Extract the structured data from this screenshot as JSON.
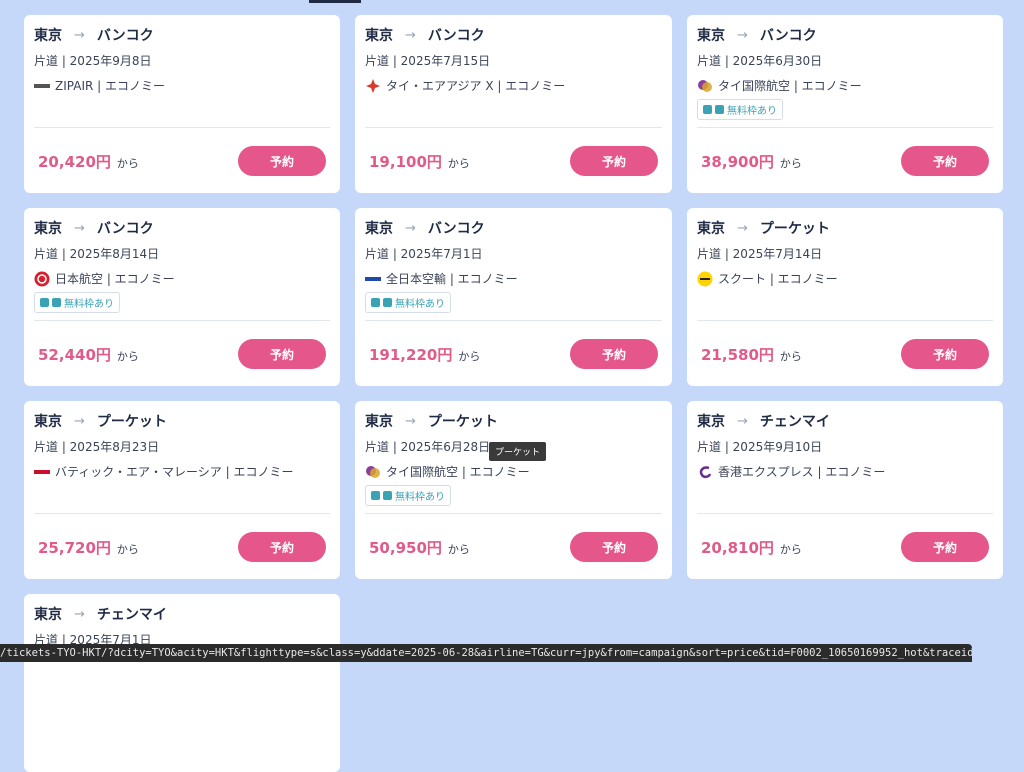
{
  "colors": {
    "page_background": "#c6d8f9",
    "price": "#e05a8a",
    "button": "#e5578a",
    "badge_text": "#3aa2b5"
  },
  "common": {
    "arrow": "→",
    "from_suffix": "から",
    "book_label": "予約",
    "free_baggage_label": "無料枠あり"
  },
  "cards": [
    {
      "from": "東京",
      "to": "バンコク",
      "date": "片道 | 2025年9月8日",
      "airline": "ZIPAIR | エコノミー",
      "logo": "zipair-logo",
      "badge": false,
      "price": "20,420円"
    },
    {
      "from": "東京",
      "to": "バンコク",
      "date": "片道 | 2025年7月15日",
      "airline": "タイ・エアアジア X | エコノミー",
      "logo": "airasia-logo",
      "badge": false,
      "price": "19,100円"
    },
    {
      "from": "東京",
      "to": "バンコク",
      "date": "片道 | 2025年6月30日",
      "airline": "タイ国際航空 | エコノミー",
      "logo": "thai-airways-logo",
      "badge": true,
      "price": "38,900円"
    },
    {
      "from": "東京",
      "to": "バンコク",
      "date": "片道 | 2025年8月14日",
      "airline": "日本航空 | エコノミー",
      "logo": "jal-logo",
      "badge": true,
      "price": "52,440円"
    },
    {
      "from": "東京",
      "to": "バンコク",
      "date": "片道 | 2025年7月1日",
      "airline": "全日本空輸 | エコノミー",
      "logo": "ana-logo",
      "badge": true,
      "price": "191,220円"
    },
    {
      "from": "東京",
      "to": "プーケット",
      "date": "片道 | 2025年7月14日",
      "airline": "スクート | エコノミー",
      "logo": "scoot-logo",
      "badge": false,
      "price": "21,580円"
    },
    {
      "from": "東京",
      "to": "プーケット",
      "date": "片道 | 2025年8月23日",
      "airline": "バティック・エア・マレーシア | エコノミー",
      "logo": "batik-air-logo",
      "badge": false,
      "price": "25,720円"
    },
    {
      "from": "東京",
      "to": "プーケット",
      "date": "片道 | 2025年6月28日",
      "airline": "タイ国際航空 | エコノミー",
      "logo": "thai-airways-logo",
      "badge": true,
      "price": "50,950円"
    },
    {
      "from": "東京",
      "to": "チェンマイ",
      "date": "片道 | 2025年9月10日",
      "airline": "香港エクスプレス | エコノミー",
      "logo": "hk-express-logo",
      "badge": false,
      "price": "20,810円"
    },
    {
      "from": "東京",
      "to": "チェンマイ",
      "date": "片道 | 2025年7月1日",
      "airline": "",
      "logo": "",
      "badge": false,
      "price": ""
    }
  ],
  "tooltip": "プーケット",
  "status_url": "/tickets-TYO-HKT/?dcity=TYO&acity=HKT&flighttype=s&class=y&ddate=2025-06-28&airline=TG&curr=jpy&from=campaign&sort=price&tid=F0002_10650169952_hot&traceid=1-o54oe3ps5c0o"
}
